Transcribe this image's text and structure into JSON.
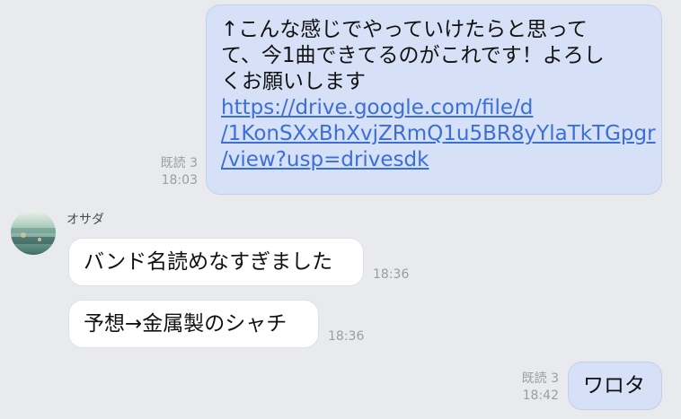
{
  "messages": {
    "out1": {
      "lines": [
        "↑こんな感じでやっていけたらと思って",
        "て、今1曲できてるのがこれです！よろし",
        "くお願いします"
      ],
      "link_lines": [
        "https://drive.google.com/file/d",
        "/1KonSXxBhXvjZRmQ1u5BR8yYlaTkTGpgr",
        "/view?usp=drivesdk"
      ],
      "read": "既読 3",
      "time": "18:03"
    },
    "in_sender": "オサダ",
    "in1": {
      "text": "バンド名読めなすぎました",
      "time": "18:36"
    },
    "in2": {
      "text": "予想→金属製のシャチ",
      "time": "18:36"
    },
    "out2": {
      "text": "ワロタ",
      "read": "既読 3",
      "time": "18:42"
    }
  },
  "colors": {
    "background": "#e9eaee",
    "outgoing_bubble": "#d6e1f7",
    "incoming_bubble": "#ffffff",
    "link": "#3b6fd8",
    "meta_text": "#9b9da3"
  }
}
